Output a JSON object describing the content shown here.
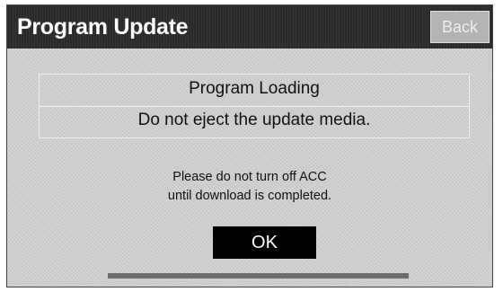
{
  "header": {
    "title": "Program Update",
    "back_label": "Back"
  },
  "message": {
    "line1": "Program Loading",
    "line2": "Do not eject the update media."
  },
  "note": {
    "line1": "Please do not turn off ACC",
    "line2": "until download is completed."
  },
  "ok_label": "OK",
  "progress": {
    "fraction": 1.0
  },
  "colors": {
    "header_bg": "#2a2a2a",
    "content_bg": "#d0d0d0",
    "ok_bg": "#000000",
    "back_bg": "#b3b3b3"
  }
}
